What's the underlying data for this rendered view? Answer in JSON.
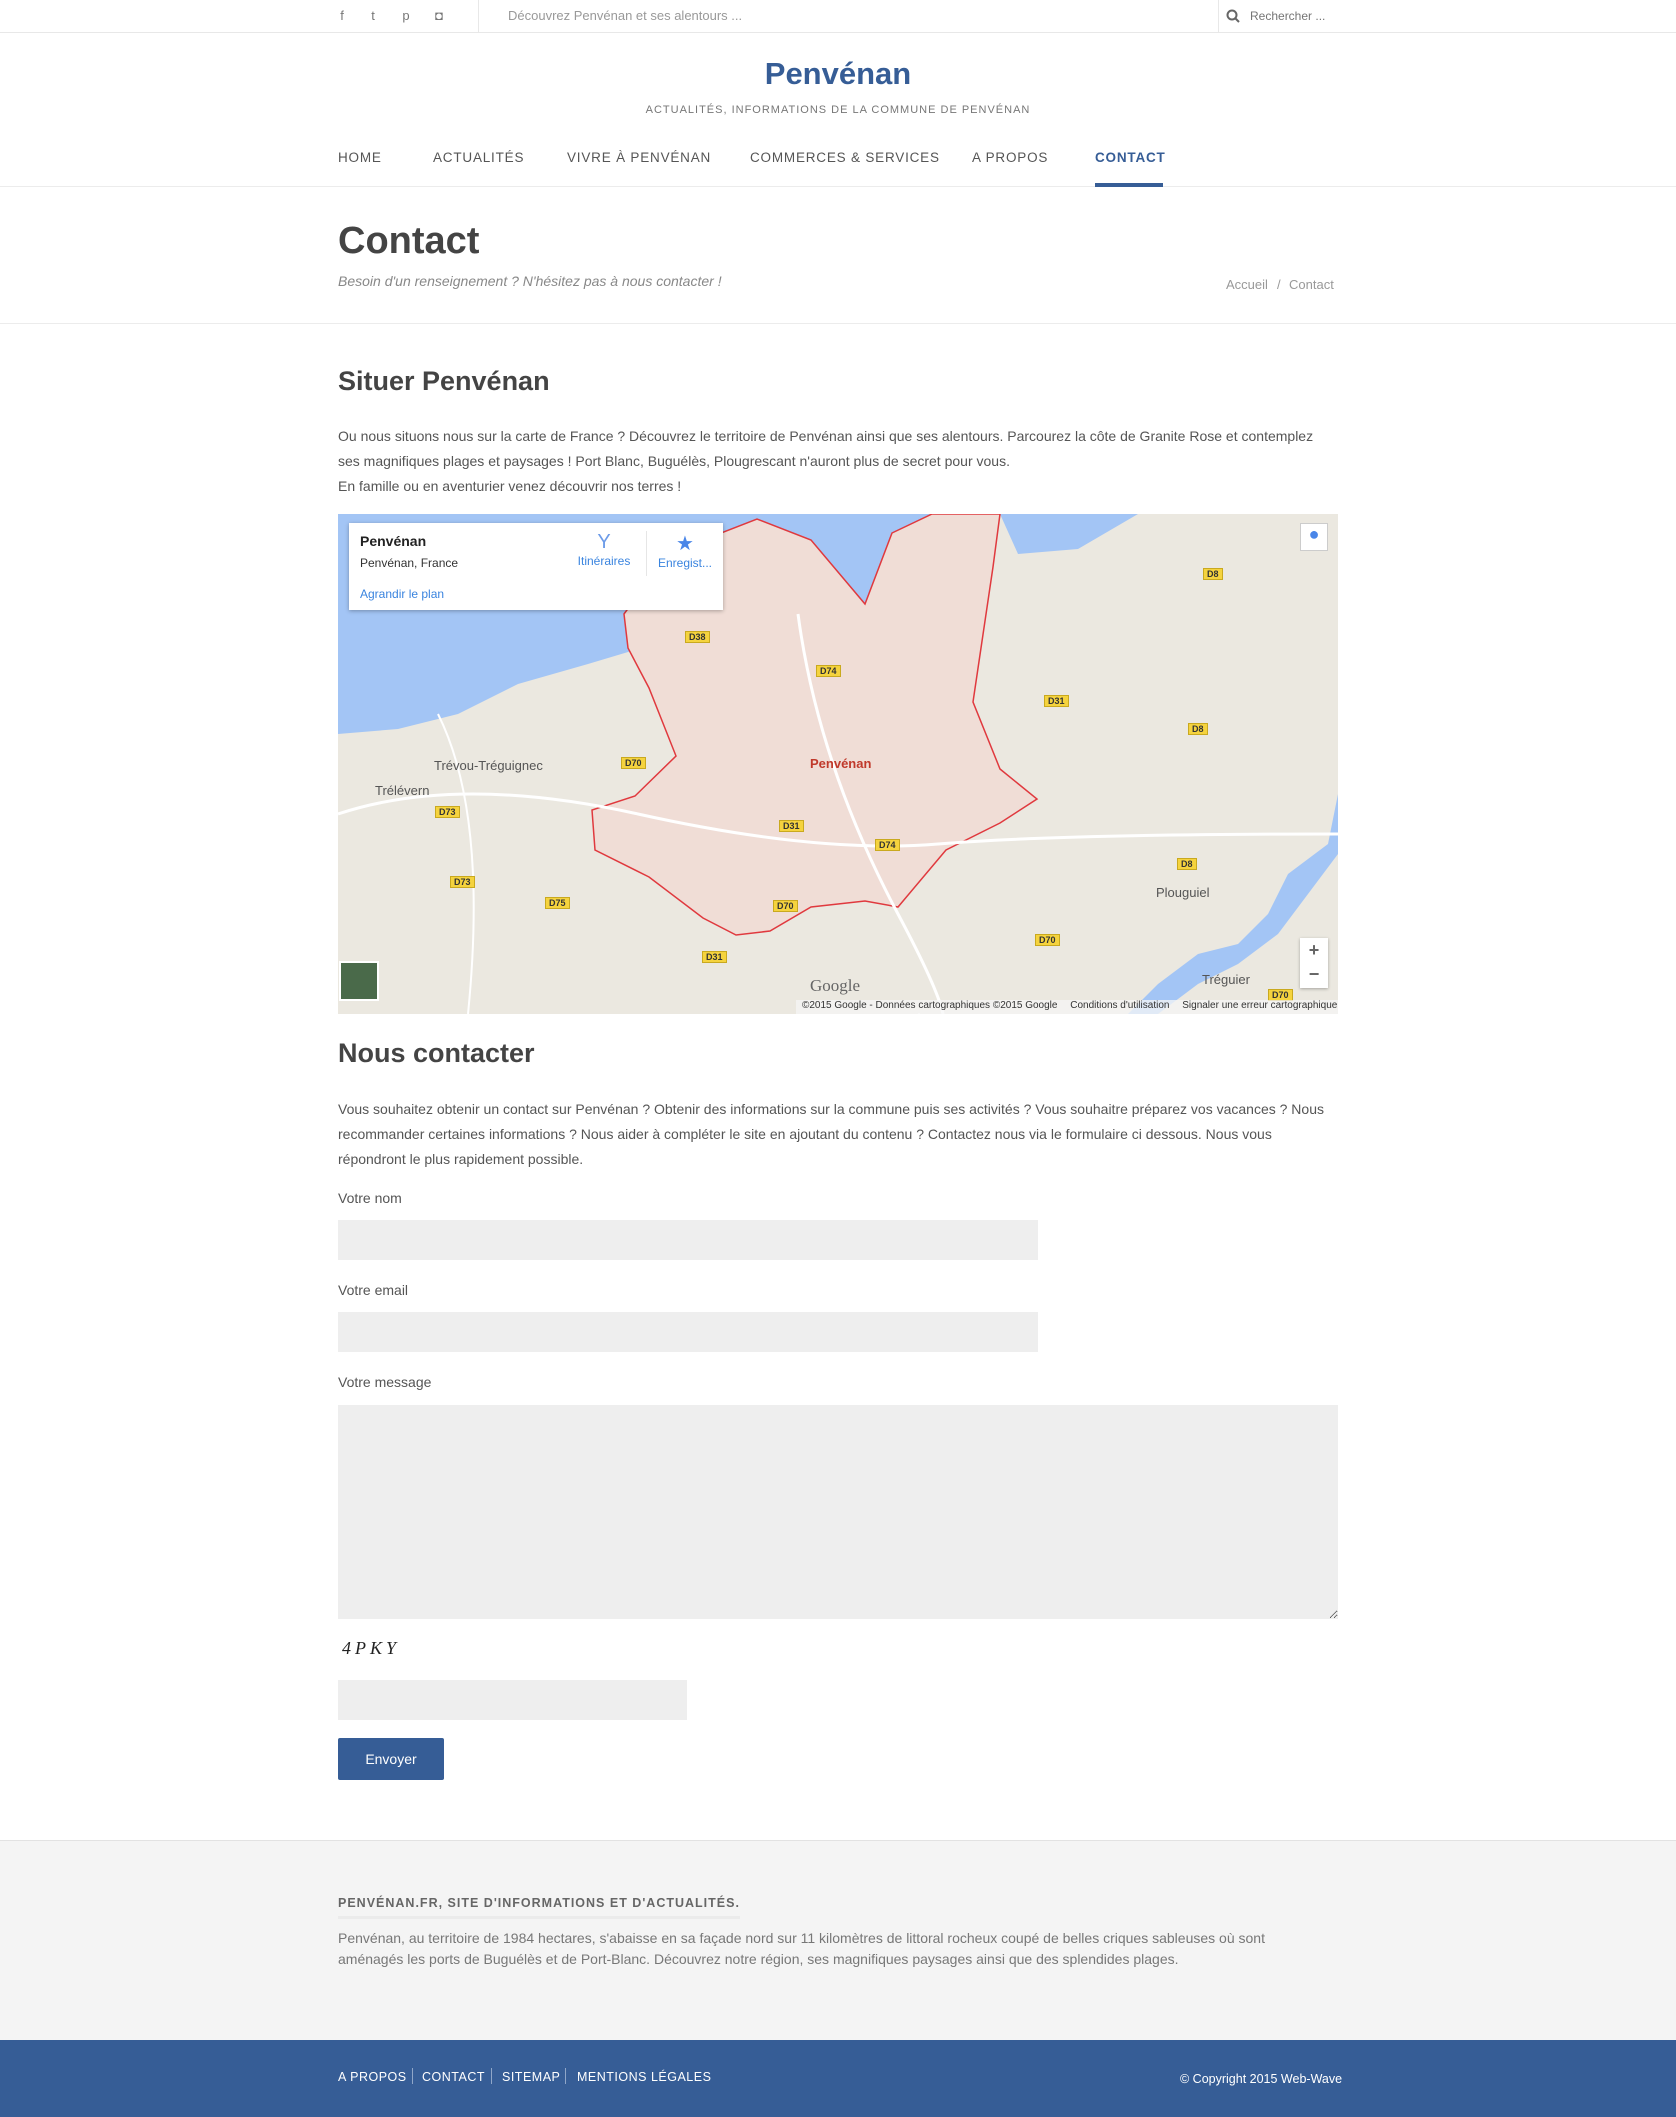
{
  "topbar": {
    "social": [
      {
        "icon": "facebook-icon",
        "glyph": "f"
      },
      {
        "icon": "twitter-icon",
        "glyph": "t"
      },
      {
        "icon": "pinterest-icon",
        "glyph": "p"
      },
      {
        "icon": "instagram-icon",
        "glyph": "◘"
      }
    ],
    "tagline": "Découvrez Penvénan et ses alentours ...",
    "search_placeholder": "Rechercher ..."
  },
  "header": {
    "title": "Penvénan",
    "tagline": "ACTUALITÉS, INFORMATIONS DE LA COMMUNE DE PENVÉNAN"
  },
  "nav": [
    {
      "label": "HOME"
    },
    {
      "label": "ACTUALITÉS"
    },
    {
      "label": "VIVRE À PENVÉNAN"
    },
    {
      "label": "COMMERCES & SERVICES"
    },
    {
      "label": "A PROPOS"
    },
    {
      "label": "CONTACT",
      "active": true
    }
  ],
  "page": {
    "title": "Contact",
    "subtitle": "Besoin d'un renseignement ? N'hésitez pas à nous contacter !",
    "breadcrumb": [
      "Accueil",
      "/",
      "Contact"
    ]
  },
  "situer": {
    "title": "Situer Penvénan",
    "p1": "Ou nous situons nous sur la carte de France ? Découvrez le territoire de Penvénan ainsi que ses alentours. Parcourez la côte de Granite Rose et contemplez ses magnifiques plages et paysages ! Port Blanc, Buguélès, Plougrescant n'auront plus de secret pour vous.",
    "p2": "En famille ou en aventurier venez découvrir nos terres !"
  },
  "map": {
    "card": {
      "title": "Penvénan",
      "address": "Penvénan, France",
      "directions": "Itinéraires",
      "save": "Enregist...",
      "enlarge": "Agrandir le plan"
    },
    "places": [
      {
        "name": "Penvénan",
        "main": true
      },
      {
        "name": "Trévou-Tréguignec"
      },
      {
        "name": "Trélévern"
      },
      {
        "name": "Plouguiel"
      },
      {
        "name": "Tréguier"
      }
    ],
    "roads": [
      "D38",
      "D74",
      "D31",
      "D8",
      "D8",
      "D70",
      "D73",
      "D73",
      "D75",
      "D31",
      "D74",
      "D70",
      "D31",
      "D70",
      "D8",
      "D70"
    ],
    "logo": "Google",
    "copyright": "©2015 Google - Données cartographiques ©2015 Google",
    "terms": "Conditions d'utilisation",
    "report": "Signaler une erreur cartographique",
    "zoom_in": "+",
    "zoom_out": "−",
    "colors": {
      "sea": "#a3c5f5",
      "land": "#ebe8e0",
      "commune": "#f0ddd6",
      "border": "#e0393e"
    }
  },
  "contact": {
    "title": "Nous contacter",
    "intro": "Vous souhaitez obtenir un contact sur Penvénan ? Obtenir des informations sur la commune puis ses activités ? Vous souhaitre préparez vos vacances ? Nous recommander certaines informations ? Nous aider à compléter le site en ajoutant du contenu ? Contactez nous via le formulaire ci dessous. Nous vous répondront le plus rapidement possible.",
    "name_label": "Votre nom",
    "email_label": "Votre email",
    "message_label": "Votre message",
    "captcha": "4PKY",
    "submit": "Envoyer"
  },
  "footer": {
    "heading": "PENVÉNAN.FR, SITE D'INFORMATIONS ET D'ACTUALITÉS.",
    "text": "Penvénan, au territoire de 1984 hectares, s'abaisse en sa façade nord sur 11 kilomètres de littoral rocheux coupé de belles criques sableuses où sont aménagés les ports de Buguélès et de Port-Blanc. Découvrez notre région, ses magnifiques paysages ainsi que des splendides plages.",
    "links": [
      "A PROPOS",
      "CONTACT",
      "SITEMAP",
      "MENTIONS LÉGALES"
    ],
    "copyright": "© Copyright 2015 Web-Wave"
  },
  "colors": {
    "brand": "#365d96",
    "footer_bg": "#f4f4f4",
    "input_bg": "#eeeeee"
  }
}
